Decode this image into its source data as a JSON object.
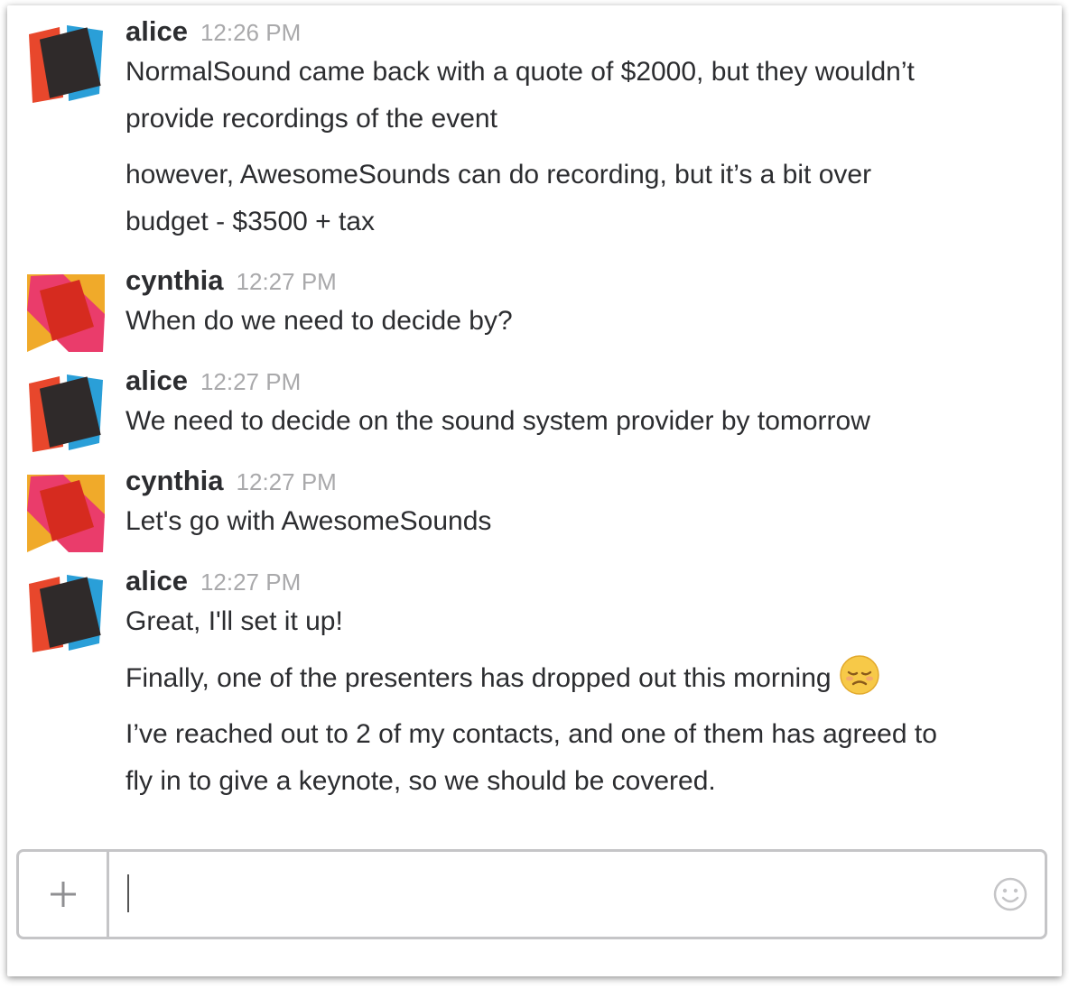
{
  "messages": [
    {
      "author": "alice",
      "time": "12:26 PM",
      "avatar": "alice-avatar",
      "lines": [
        "NormalSound came back with a quote of $2000, but they wouldn’t",
        "provide recordings of the event",
        "however, AwesomeSounds can do recording, but it’s a bit over",
        "budget - $3500 + tax"
      ]
    },
    {
      "author": "cynthia",
      "time": "12:27 PM",
      "avatar": "cynthia-avatar",
      "lines": [
        "When do we need to decide by?"
      ]
    },
    {
      "author": "alice",
      "time": "12:27 PM",
      "avatar": "alice-avatar",
      "lines": [
        "We need to decide on the sound system provider by tomorrow"
      ]
    },
    {
      "author": "cynthia",
      "time": "12:27 PM",
      "avatar": "cynthia-avatar",
      "lines": [
        "Let's go with AwesomeSounds"
      ]
    },
    {
      "author": "alice",
      "time": "12:27 PM",
      "avatar": "alice-avatar",
      "lines": [
        "Great, I'll set it up!",
        "Finally, one of the presenters has dropped out this morning",
        "I’ve reached out to 2 of my contacts, and one of them has agreed to",
        "fly in to give a keynote, so we should be covered."
      ],
      "emoji": "disappointed-face-emoji"
    }
  ],
  "composer": {
    "value": "",
    "plus_icon": "plus-icon",
    "emoji_icon": "smiley-icon"
  },
  "colors": {
    "alice_avatar": [
      "#e8472c",
      "#2a9fd8",
      "#2f2a2a"
    ],
    "cynthia_avatar": [
      "#f0aa2a",
      "#ea3c6b",
      "#d62b1f"
    ],
    "text": "#2c2d30",
    "timestamp": "#a9a9ab",
    "border": "#c5c5c7"
  }
}
